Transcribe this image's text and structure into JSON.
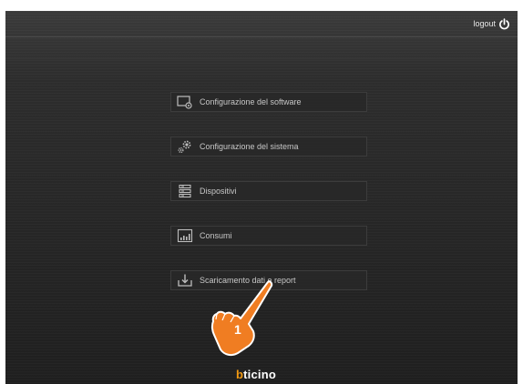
{
  "header": {
    "logout_label": "logout",
    "logout_icon": "power-icon"
  },
  "menu": {
    "items": [
      {
        "label": "Configurazione del software",
        "icon": "monitor-gear-icon"
      },
      {
        "label": "Configurazione del sistema",
        "icon": "gears-icon"
      },
      {
        "label": "Dispositivi",
        "icon": "device-list-icon"
      },
      {
        "label": "Consumi",
        "icon": "consumption-chart-icon"
      },
      {
        "label": "Scaricamento dati e report",
        "icon": "download-icon"
      }
    ]
  },
  "annotation": {
    "step_number": "1",
    "icon": "pointing-hand-icon",
    "color": "#f07d22"
  },
  "footer": {
    "brand_first": "b",
    "brand_rest": "ticino",
    "brand_accent_color": "#f39a12"
  },
  "colors": {
    "background": "#2a2a2a",
    "menu_text": "#c7c7c7",
    "header_text": "#e8e8e8"
  }
}
